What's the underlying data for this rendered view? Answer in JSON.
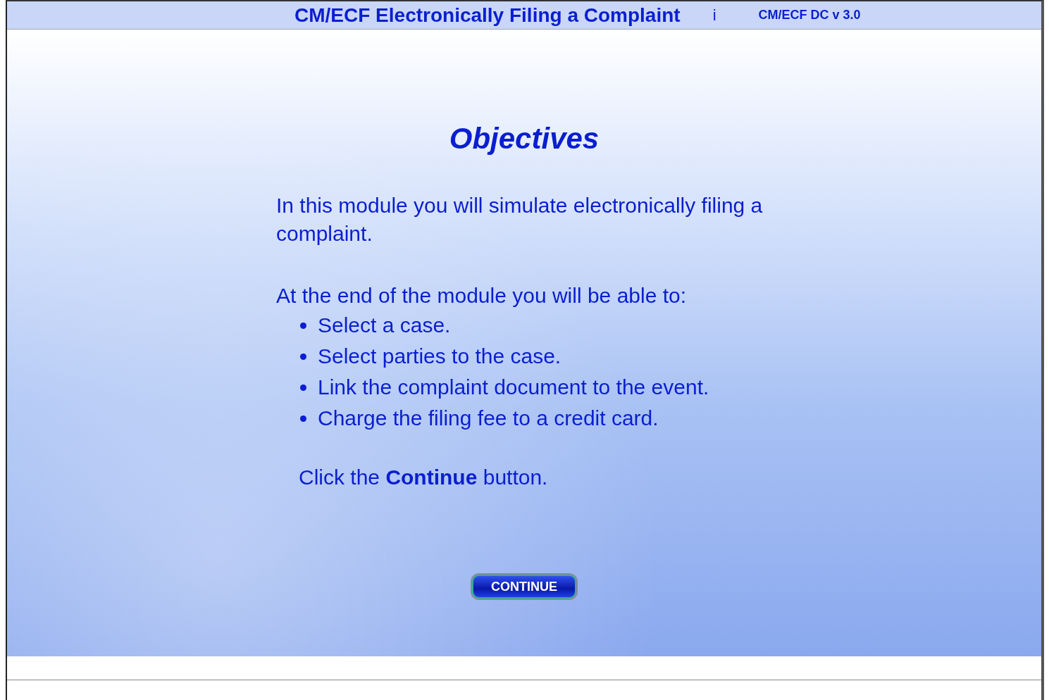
{
  "header": {
    "title": "CM/ECF Electronically Filing a Complaint",
    "info": "i",
    "version": "CM/ECF DC v 3.0"
  },
  "heading": "Objectives",
  "intro": "In this module you will simulate electronically filing a complaint.",
  "lead_in": "At the end of the module you will be able to:",
  "objectives": [
    "Select a case.",
    "Select parties to the case.",
    "Link the complaint document to the event.",
    "Charge the filing fee to a credit card."
  ],
  "instruction": "Click the **Continue** button.",
  "button": "CONTINUE"
}
